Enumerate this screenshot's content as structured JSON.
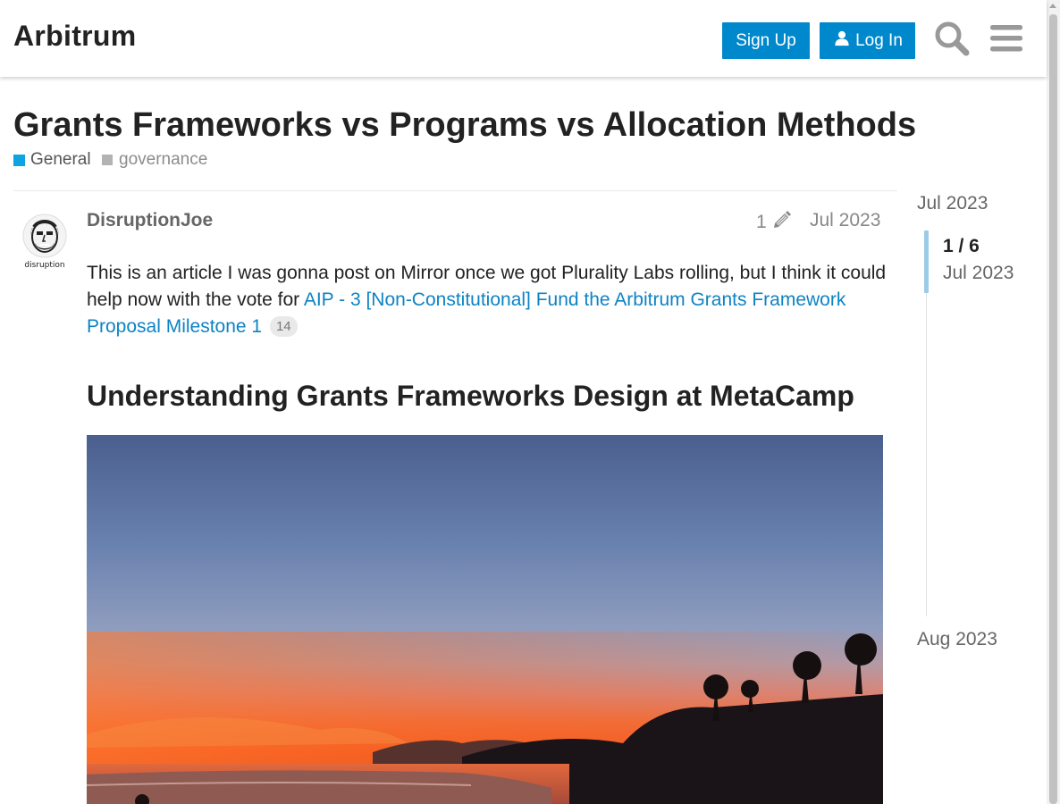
{
  "header": {
    "site_title": "Arbitrum",
    "signup_label": "Sign Up",
    "login_label": "Log In",
    "icons": [
      "user-icon",
      "search-icon",
      "hamburger-menu-icon"
    ],
    "accent_color": "#0088cc"
  },
  "topic": {
    "title": "Grants Frameworks vs Programs vs Allocation Methods",
    "category": "General",
    "category_color": "#0ea4e1",
    "tag": "governance"
  },
  "post": {
    "username": "DisruptionJoe",
    "avatar_text": "disruption",
    "edit_count": "1",
    "date": "Jul 2023",
    "body_text": "This is an article I was gonna post on Mirror once we got Plurality Labs rolling, but I think it could help now with the vote for ",
    "link_text": "AIP - 3 [Non-Constitutional] Fund the Arbitrum Grants Framework Proposal Milestone 1",
    "link_clicks": "14",
    "heading": "Understanding Grants Frameworks Design at MetaCamp"
  },
  "timeline": {
    "start_date": "Jul 2023",
    "position": "1 / 6",
    "position_date": "Jul 2023",
    "end_date": "Aug 2023"
  }
}
